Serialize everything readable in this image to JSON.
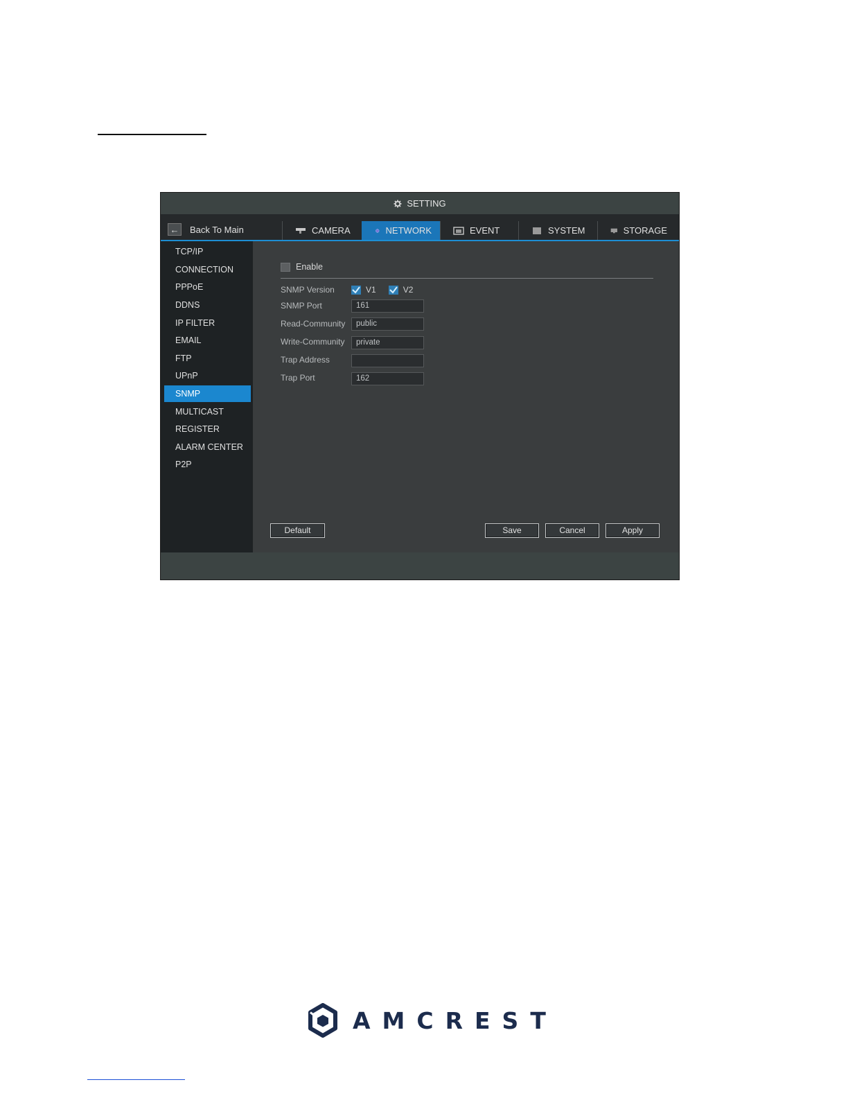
{
  "window": {
    "title": "SETTING",
    "back_label": "Back To Main",
    "tabs": [
      {
        "label": "CAMERA",
        "icon": "camera-icon",
        "active": false
      },
      {
        "label": "NETWORK",
        "icon": "globe-icon",
        "active": true
      },
      {
        "label": "EVENT",
        "icon": "event-icon",
        "active": false
      },
      {
        "label": "SYSTEM",
        "icon": "system-icon",
        "active": false
      },
      {
        "label": "STORAGE",
        "icon": "storage-icon",
        "active": false
      }
    ]
  },
  "sidebar": {
    "items": [
      {
        "label": "TCP/IP"
      },
      {
        "label": "CONNECTION"
      },
      {
        "label": "PPPoE"
      },
      {
        "label": "DDNS"
      },
      {
        "label": "IP FILTER"
      },
      {
        "label": "EMAIL"
      },
      {
        "label": "FTP"
      },
      {
        "label": "UPnP"
      },
      {
        "label": "SNMP",
        "active": true
      },
      {
        "label": "MULTICAST"
      },
      {
        "label": "REGISTER"
      },
      {
        "label": "ALARM CENTER"
      },
      {
        "label": "P2P"
      }
    ]
  },
  "snmp": {
    "enable_label": "Enable",
    "enable_checked": false,
    "version_label": "SNMP Version",
    "v1_label": "V1",
    "v1_checked": true,
    "v2_label": "V2",
    "v2_checked": true,
    "port_label": "SNMP Port",
    "port_value": "161",
    "read_community_label": "Read-Community",
    "read_community_value": "public",
    "write_community_label": "Write-Community",
    "write_community_value": "private",
    "trap_address_label": "Trap Address",
    "trap_address_value": "",
    "trap_port_label": "Trap Port",
    "trap_port_value": "162"
  },
  "buttons": {
    "default": "Default",
    "save": "Save",
    "cancel": "Cancel",
    "apply": "Apply"
  },
  "colors": {
    "accent": "#1b87cf",
    "active_tab": "#1b76b9",
    "brand": "#1c2c4d"
  },
  "footer": {
    "brand": "AMCREST"
  }
}
